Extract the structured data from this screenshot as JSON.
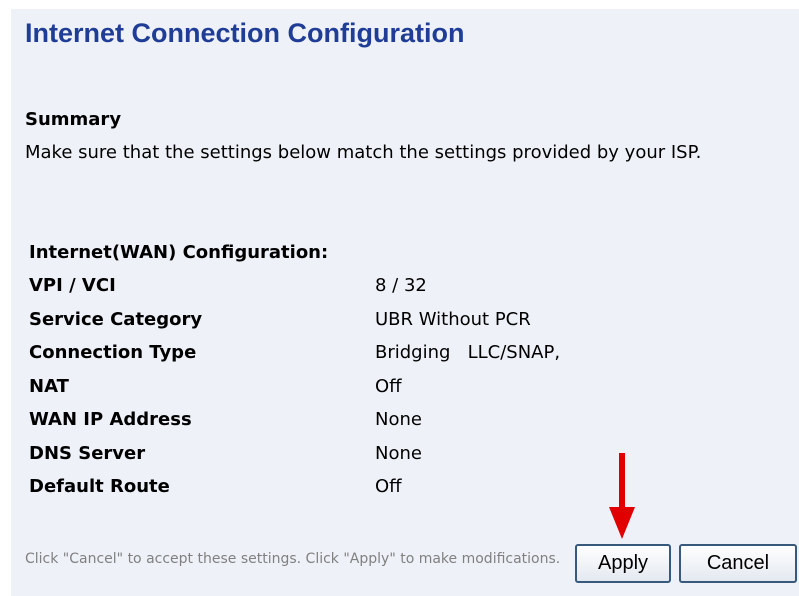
{
  "page": {
    "title": "Internet Connection Configuration"
  },
  "summary": {
    "heading": "Summary",
    "text": "Make sure that the settings below match the settings provided by your ISP."
  },
  "config": {
    "heading": "Internet(WAN) Configuration:",
    "rows": [
      {
        "label": "VPI / VCI",
        "value": "8 / 32"
      },
      {
        "label": "Service Category",
        "value": "UBR Without PCR"
      },
      {
        "label": "Connection Type",
        "value": "Bridging   LLC/SNAP,"
      },
      {
        "label": "NAT",
        "value": "Off"
      },
      {
        "label": "WAN IP Address",
        "value": "None"
      },
      {
        "label": "DNS Server",
        "value": "None"
      },
      {
        "label": "Default Route",
        "value": "Off"
      }
    ]
  },
  "footer": {
    "note": "Click \"Cancel\" to accept these settings. Click \"Apply\" to make modifications.",
    "apply_label": "Apply",
    "cancel_label": "Cancel"
  },
  "annotation": {
    "arrow_color": "#e00000",
    "arrow_icon": "arrow-down-icon"
  },
  "colors": {
    "title": "#1f3c96",
    "panel_background": "#eef2f8",
    "button_border": "#36597c",
    "footer_text": "#808080"
  }
}
